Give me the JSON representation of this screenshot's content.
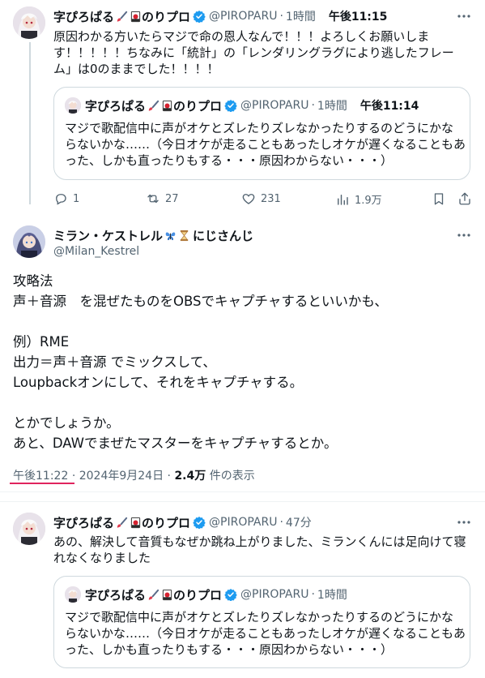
{
  "colors": {
    "verified": "#1d9bf0",
    "text": "#0f1419",
    "muted": "#536471",
    "border": "#cfd9de",
    "underline": "#e0245e"
  },
  "tweet1": {
    "display_name": "字ぴろぱる",
    "suffix": "のりプロ",
    "handle": "@PIROPARU",
    "ago": "1時間",
    "time": "午後11:15",
    "text": "原因わかる方いたらマジで命の恩人なんで！！！よろしくお願いしま\nす！！！！！ちなみに「統計」の「レンダリングラグにより逃したフレー\nム」は0のままでした！！！！",
    "quote": {
      "display_name": "字ぴろぱる",
      "suffix": "のりプロ",
      "handle": "@PIROPARU",
      "ago": "1時間",
      "time": "午後11:14",
      "text": "マジで歌配信中に声がオケとズレたりズレなかったりするのどうにかな\nらないかな……（今日オケが走ることもあったしオケが遅くなることもあ\nった、しかも直ったりもする・・・原因わからない・・・）"
    },
    "actions": {
      "replies": "1",
      "retweets": "27",
      "likes": "231",
      "views": "1.9万"
    }
  },
  "tweet2": {
    "display_name": "ミラン・ケストレル",
    "suffix": "にじさんじ",
    "handle": "@Milan_Kestrel",
    "text": "攻略法\n声＋音源　を混ぜたものをOBSでキャプチャするといいかも、\n\n例）RME\n出力＝声＋音源 でミックスして、\nLoupbackオンにして、それをキャプチャする。\n\nとかでしょうか。\nあと、DAWでまぜたマスターをキャプチャするとか。",
    "time": "午後11:22",
    "date": "2024年9月24日",
    "views_count": "2.4万",
    "views_label": "件の表示"
  },
  "tweet3": {
    "display_name": "字ぴろぱる",
    "suffix": "のりプロ",
    "handle": "@PIROPARU",
    "ago": "47分",
    "text": "あの、解決して音質もなぜか跳ね上がりました、ミランくんには足向けて寝\nれなくなりました",
    "quote": {
      "display_name": "字ぴろぱる",
      "suffix": "のりプロ",
      "handle": "@PIROPARU",
      "ago": "1時間",
      "text": "マジで歌配信中に声がオケとズレたりズレなかったりするのどうにかな\nらないかな……（今日オケが走ることもあったしオケが遅くなることもあ\nった、しかも直ったりもする・・・原因わからない・・・）"
    }
  }
}
